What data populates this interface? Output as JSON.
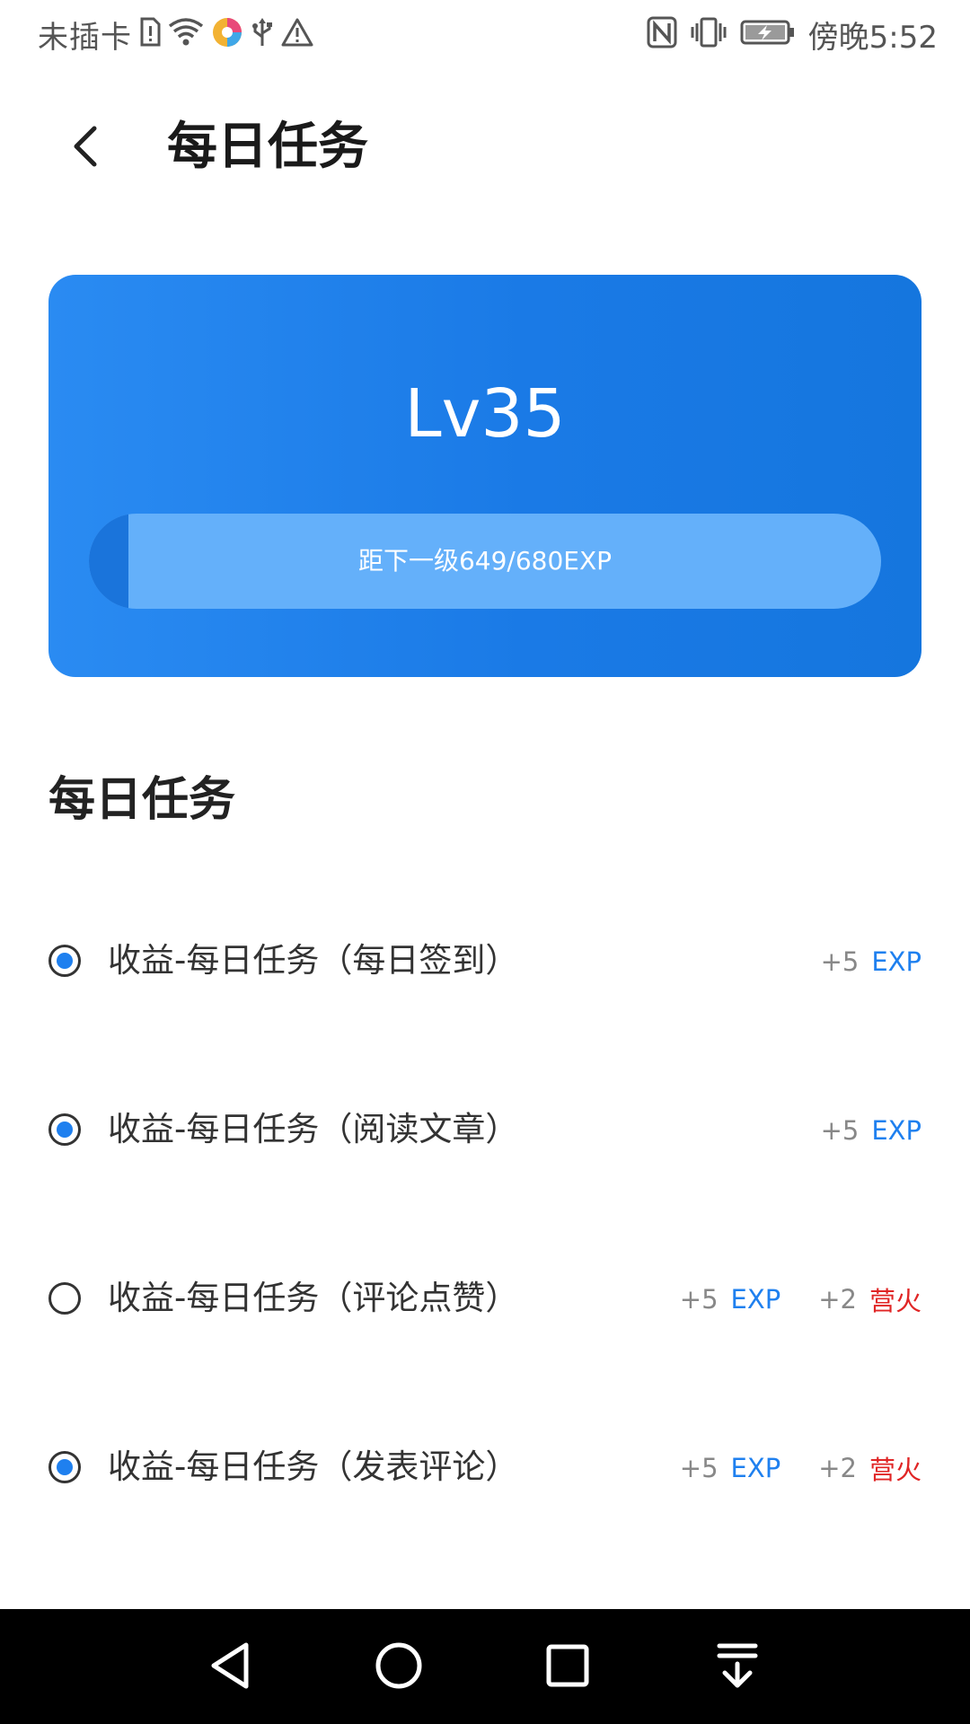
{
  "status_bar": {
    "carrier": "未插卡",
    "time": "傍晚5:52",
    "icons": [
      "sim-alert-icon",
      "wifi-icon",
      "app-notification-icon",
      "usb-icon",
      "warning-icon",
      "nfc-icon",
      "vibrate-icon",
      "battery-charging-icon"
    ]
  },
  "header": {
    "title": "每日任务",
    "back_icon": "back-arrow-icon"
  },
  "level_card": {
    "level": "Lv35",
    "progress_text": "距下一级649/680EXP",
    "progress_fraction": 0.05,
    "colors": {
      "card": "#1a7ae6",
      "track": "#64b0fa",
      "fill": "#1a74db"
    }
  },
  "section": {
    "title": "每日任务"
  },
  "tasks": [
    {
      "label": "收益-每日任务（每日签到）",
      "checked": true,
      "rewards": [
        {
          "amount": "+5",
          "unit": "EXP",
          "type": "exp"
        }
      ]
    },
    {
      "label": "收益-每日任务（阅读文章）",
      "checked": true,
      "rewards": [
        {
          "amount": "+5",
          "unit": "EXP",
          "type": "exp"
        }
      ]
    },
    {
      "label": "收益-每日任务（评论点赞）",
      "checked": false,
      "rewards": [
        {
          "amount": "+5",
          "unit": "EXP",
          "type": "exp"
        },
        {
          "amount": "+2",
          "unit": "营火",
          "type": "fire"
        }
      ]
    },
    {
      "label": "收益-每日任务（发表评论）",
      "checked": true,
      "rewards": [
        {
          "amount": "+5",
          "unit": "EXP",
          "type": "exp"
        },
        {
          "amount": "+2",
          "unit": "营火",
          "type": "fire"
        }
      ]
    }
  ],
  "nav_bar": {
    "buttons": [
      "back-triangle-icon",
      "home-circle-icon",
      "recents-square-icon",
      "notification-pulldown-icon"
    ]
  },
  "colors": {
    "accent": "#1f80ef",
    "fire": "#e02525",
    "muted": "#888888"
  }
}
